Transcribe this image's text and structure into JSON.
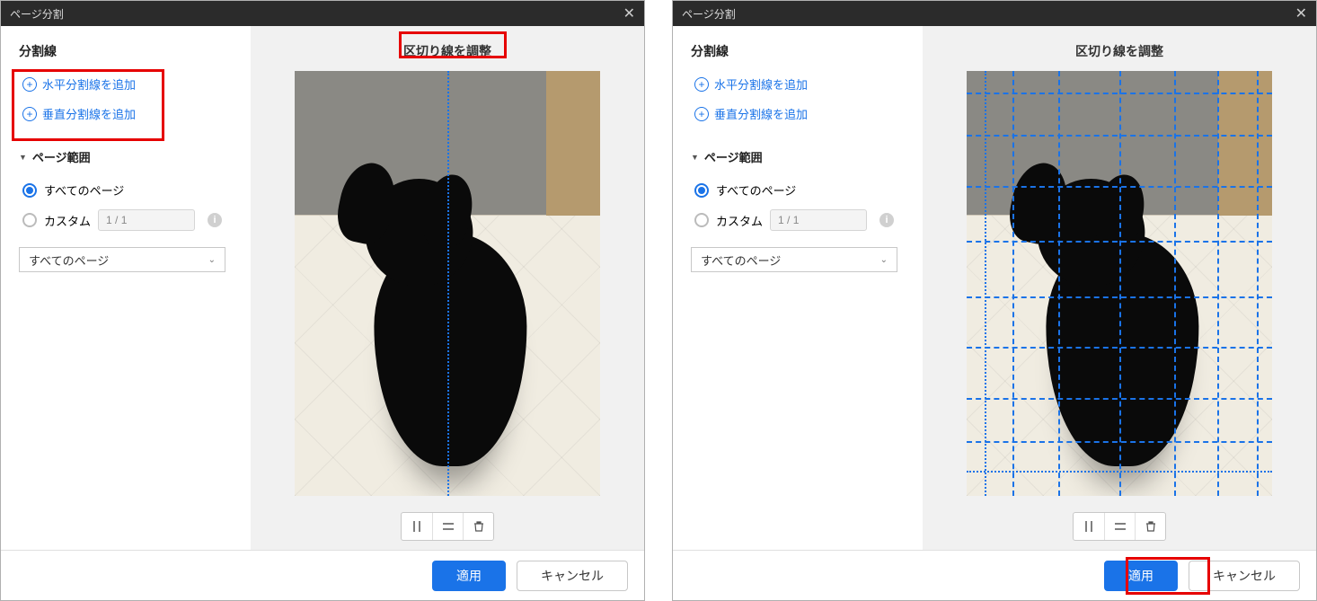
{
  "dialog": {
    "title": "ページ分割"
  },
  "sidebar": {
    "split_lines_title": "分割線",
    "add_horizontal": "水平分割線を追加",
    "add_vertical": "垂直分割線を追加",
    "page_range_title": "ページ範囲",
    "all_pages": "すべてのページ",
    "custom": "カスタム",
    "page_value": "1 / 1",
    "dropdown_value": "すべてのページ"
  },
  "preview": {
    "title": "区切り線を調整",
    "tools": {
      "vertical": "|",
      "horizontal": "≡",
      "delete": "🗑"
    }
  },
  "footer": {
    "apply": "適用",
    "cancel": "キャンセル"
  },
  "left": {
    "split_lines": {
      "vertical_percents": [
        50
      ],
      "horizontal_percents": []
    },
    "highlights": {
      "add_links_box": true,
      "preview_title_box": true,
      "apply_button_box": false
    }
  },
  "right": {
    "split_lines": {
      "vertical_percents": [
        6,
        15,
        30,
        50,
        68,
        82,
        95
      ],
      "horizontal_percents": [
        5,
        15,
        27,
        40,
        53,
        65,
        77,
        87,
        94
      ]
    },
    "highlights": {
      "add_links_box": false,
      "preview_title_box": false,
      "apply_button_box": true
    }
  }
}
